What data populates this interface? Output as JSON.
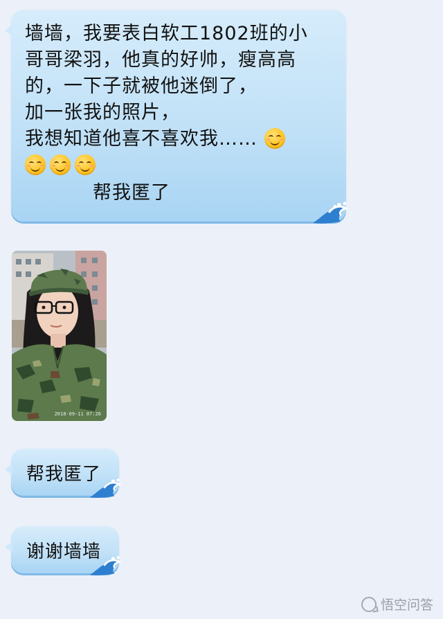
{
  "messages": [
    {
      "lines": [
        "墙墙，我要表白软工1802班的小",
        "哥哥梁羽，他真的好帅，瘦高高",
        "的，一下子就被他迷倒了，",
        "加一张我的照片，",
        "我想知道他喜不喜欢我……"
      ],
      "sub": "帮我匿了",
      "emoji": "smiling-face-emoji"
    },
    {
      "text": "帮我匿了"
    },
    {
      "text": "谢谢墙墙"
    }
  ],
  "photo": {
    "timestamp": "2018-09-11 07:26"
  },
  "watermark": {
    "text": "悟空问答"
  },
  "colors": {
    "bubble": "#c3e2f8",
    "background": "#ecf0f8"
  }
}
